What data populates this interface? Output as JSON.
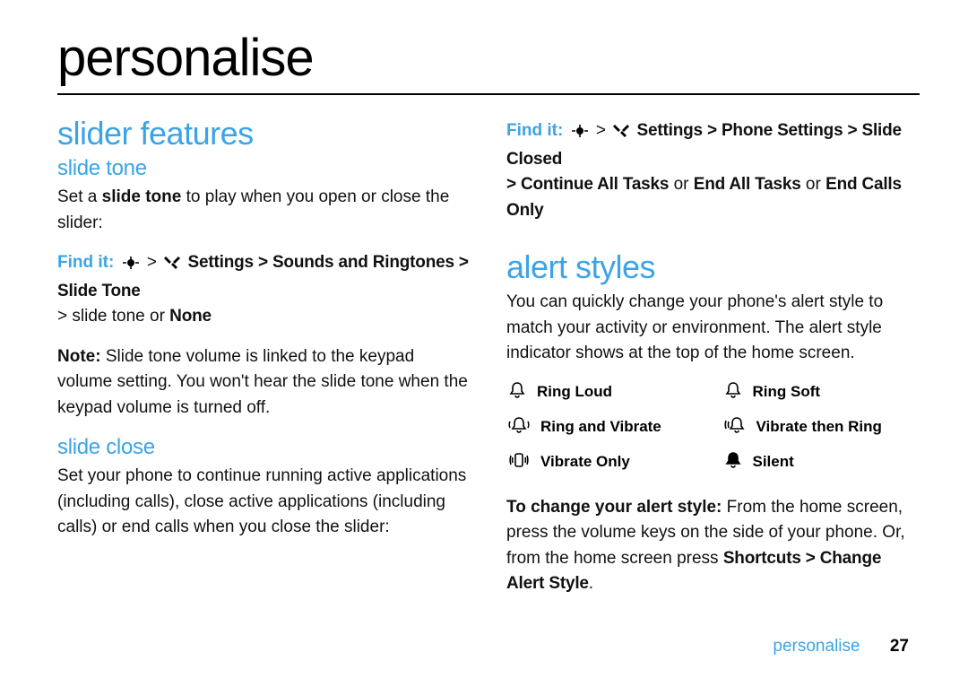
{
  "title": "personalise",
  "left": {
    "h2": "slider features",
    "slide_tone": {
      "heading": "slide tone",
      "intro_pre": "Set a ",
      "intro_bold": "slide tone",
      "intro_post": " to play when you open or close the slider:",
      "findit_label": "Find it:",
      "findit_path": "Settings > Sounds and Ringtones > Slide Tone",
      "findit_line2_a": "> slide tone",
      "findit_line2_or": " or ",
      "findit_line2_b": "None",
      "note_label": "Note:",
      "note_text": " Slide tone volume is linked to the keypad volume setting. You won't hear the slide tone when the keypad volume is turned off."
    },
    "slide_close": {
      "heading": "slide close",
      "text": "Set your phone to continue running active applications (including calls), close active applications (including calls) or end calls when you close the slider:"
    }
  },
  "right": {
    "findit_label": "Find it:",
    "findit_path": "Settings > Phone Settings > Slide Closed",
    "findit_line2_a": "> Continue All Tasks",
    "findit_line2_or1": " or ",
    "findit_line2_b": "End All Tasks",
    "findit_line2_or2": " or ",
    "findit_line2_c": "End Calls Only",
    "h2": "alert styles",
    "intro": "You can quickly change your phone's alert style to match your activity or environment. The alert style indicator shows at the top of the home screen.",
    "alerts": {
      "a1": "Ring Loud",
      "a2": "Ring Soft",
      "a3": "Ring and Vibrate",
      "a4": "Vibrate then Ring",
      "a5": "Vibrate Only",
      "a6": "Silent"
    },
    "change_bold": "To change your alert style:",
    "change_text": " From the home screen, press the volume keys on the side of your phone. Or, from the home screen press ",
    "change_path": "Shortcuts > Change Alert Style",
    "change_end": "."
  },
  "footer": {
    "section": "personalise",
    "page": "27"
  }
}
